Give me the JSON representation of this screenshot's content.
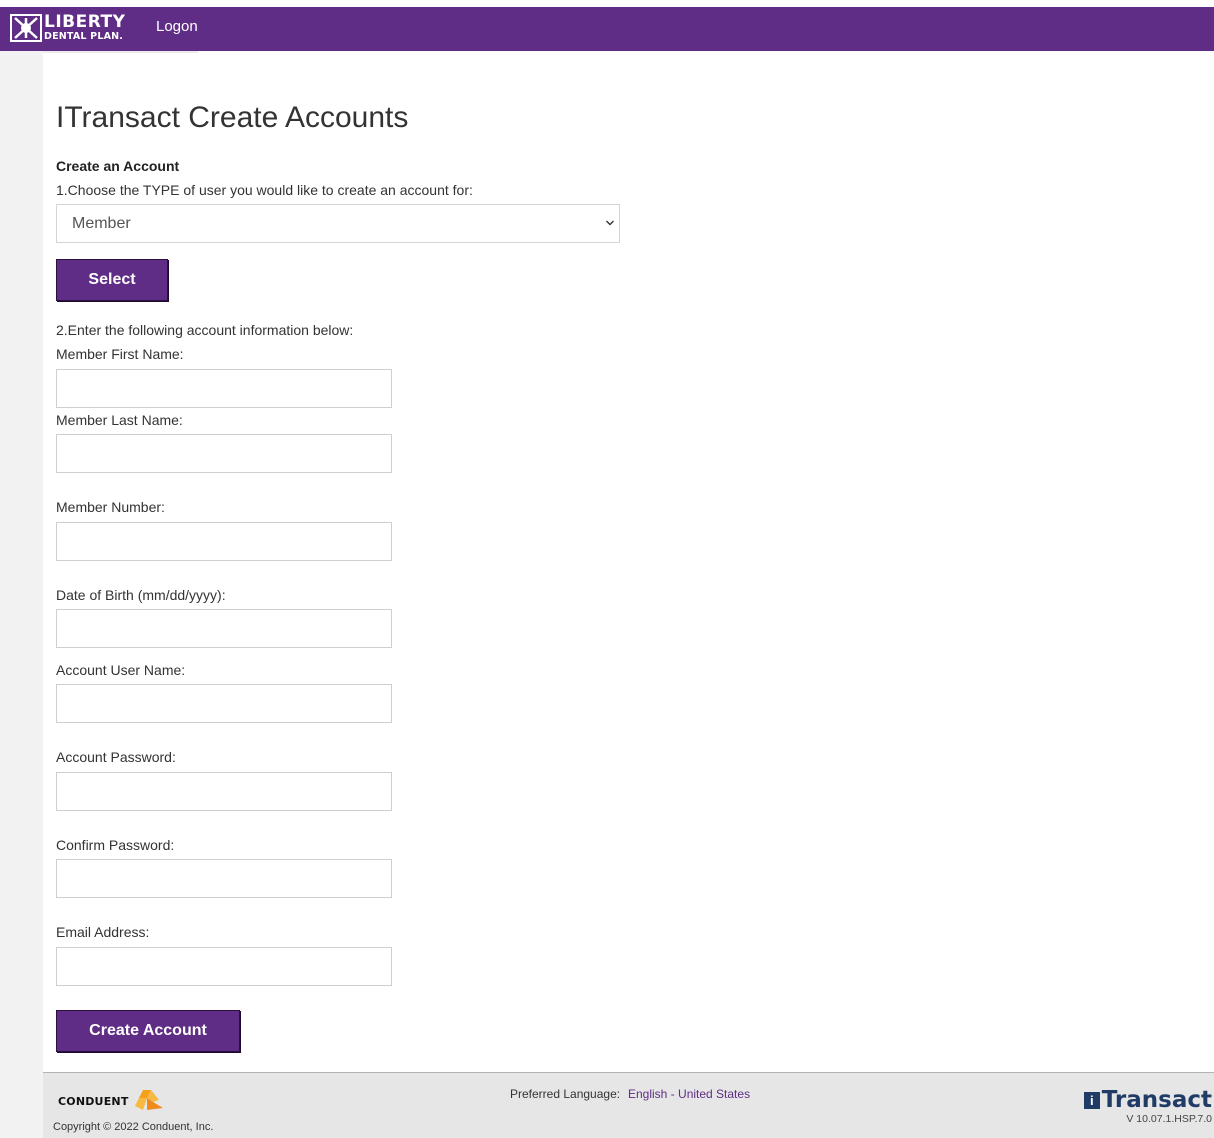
{
  "header": {
    "logo_line1": "LIBERTY",
    "logo_line2": "DENTAL PLAN.",
    "nav_logon": "Logon",
    "bg_color": "#5f2d85"
  },
  "page": {
    "title": "ITransact Create Accounts",
    "section_title": "Create an Account",
    "step1": "1.Choose the TYPE of user you would like to create an account for:",
    "user_type": {
      "selected": "Member",
      "icon": "chevron-down-icon"
    },
    "select_button": "Select",
    "step2": "2.Enter the following account information below:"
  },
  "form": {
    "fields": [
      {
        "label": "Member First Name:",
        "value": ""
      },
      {
        "label": "Member Last Name:",
        "value": ""
      },
      {
        "label": "Member Number:",
        "value": ""
      },
      {
        "label": "Date of Birth (mm/dd/yyyy):",
        "value": ""
      },
      {
        "label": "Account User Name:",
        "value": ""
      },
      {
        "label": "Account Password:",
        "value": ""
      },
      {
        "label": "Confirm Password:",
        "value": ""
      },
      {
        "label": "Email Address:",
        "value": ""
      }
    ],
    "create_button": "Create Account"
  },
  "footer": {
    "conduent": "CONDUENT",
    "copyright": "Copyright © 2022 Conduent, Inc.",
    "language_label": "Preferred Language:",
    "language_value": "English - United States",
    "product_badge": "i",
    "product": "Transact",
    "version": "V 10.07.1.HSP.7.0"
  }
}
